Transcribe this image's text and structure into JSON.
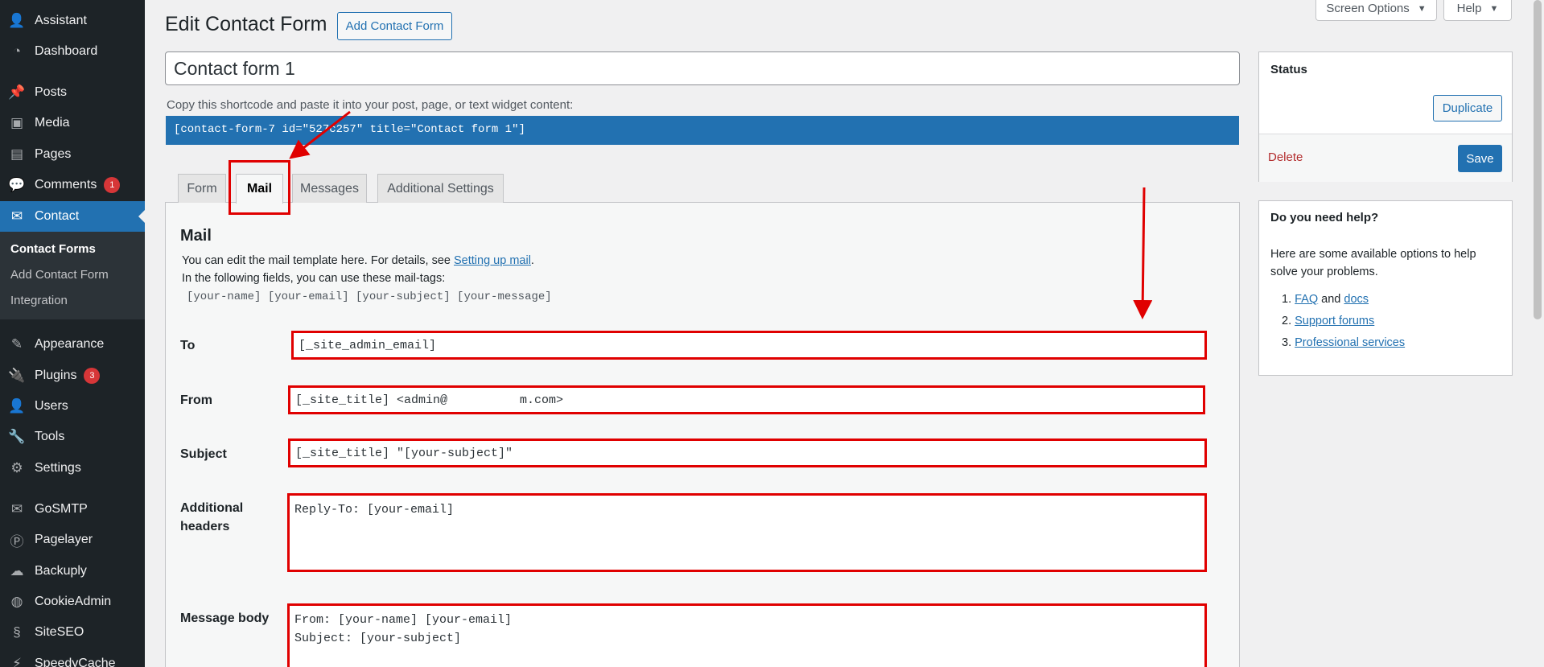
{
  "sidebar": {
    "items": [
      {
        "label": "Assistant",
        "icon": "assistant-icon",
        "glyph": "👤",
        "badge": ""
      },
      {
        "label": "Dashboard",
        "icon": "dashboard-icon",
        "glyph": "◔",
        "badge": ""
      },
      {
        "label": "Posts",
        "icon": "pin-icon",
        "glyph": "📌",
        "badge": ""
      },
      {
        "label": "Media",
        "icon": "media-icon",
        "glyph": "▣",
        "badge": ""
      },
      {
        "label": "Pages",
        "icon": "pages-icon",
        "glyph": "▤",
        "badge": ""
      },
      {
        "label": "Comments",
        "icon": "comment-icon",
        "glyph": "💬",
        "badge": "1"
      },
      {
        "label": "Contact",
        "icon": "mail-icon",
        "glyph": "✉",
        "badge": ""
      },
      {
        "label": "Appearance",
        "icon": "brush-icon",
        "glyph": "✎",
        "badge": ""
      },
      {
        "label": "Plugins",
        "icon": "plugin-icon",
        "glyph": "🔌",
        "badge": "3"
      },
      {
        "label": "Users",
        "icon": "users-icon",
        "glyph": "👤",
        "badge": ""
      },
      {
        "label": "Tools",
        "icon": "wrench-icon",
        "glyph": "🔧",
        "badge": ""
      },
      {
        "label": "Settings",
        "icon": "settings-icon",
        "glyph": "⚙",
        "badge": ""
      },
      {
        "label": "GoSMTP",
        "icon": "envelope-icon",
        "glyph": "✉",
        "badge": ""
      },
      {
        "label": "Pagelayer",
        "icon": "pagelayer-icon",
        "glyph": "Ⓟ",
        "badge": ""
      },
      {
        "label": "Backuply",
        "icon": "cloud-icon",
        "glyph": "☁",
        "badge": ""
      },
      {
        "label": "CookieAdmin",
        "icon": "cookie-icon",
        "glyph": "◍",
        "badge": ""
      },
      {
        "label": "SiteSEO",
        "icon": "siteseo-icon",
        "glyph": "§",
        "badge": ""
      },
      {
        "label": "SpeedyCache",
        "icon": "speedycache-icon",
        "glyph": "⚡",
        "badge": ""
      }
    ],
    "submenu": [
      "Contact Forms",
      "Add Contact Form",
      "Integration"
    ]
  },
  "topbar": {
    "screen_options": "Screen Options",
    "help": "Help"
  },
  "header": {
    "title": "Edit Contact Form",
    "add_new": "Add Contact Form",
    "form_title": "Contact form 1",
    "shortcode_hint": "Copy this shortcode and paste it into your post, page, or text widget content:",
    "shortcode": "[contact-form-7 id=\"527c257\" title=\"Contact form 1\"]"
  },
  "tabs": [
    "Form",
    "Mail",
    "Messages",
    "Additional Settings"
  ],
  "mail": {
    "heading": "Mail",
    "desc_prefix": "You can edit the mail template here. For details, see ",
    "desc_link": "Setting up mail",
    "desc_suffix": ".",
    "desc_line2": "In the following fields, you can use these mail-tags:",
    "mail_tags": "[your-name] [your-email] [your-subject] [your-message]",
    "fields": {
      "to_label": "To",
      "to_value": "[_site_admin_email]",
      "from_label": "From",
      "from_value": "[_site_title] <admin@          m.com>",
      "subject_label": "Subject",
      "subject_value": "[_site_title] \"[your-subject]\"",
      "headers_label_1": "Additional",
      "headers_label_2": "headers",
      "headers_value": "Reply-To: [your-email]",
      "body_label": "Message body",
      "body_value": "From: [your-name] [your-email]\nSubject: [your-subject]"
    }
  },
  "status_box": {
    "title": "Status",
    "duplicate": "Duplicate",
    "delete": "Delete",
    "save": "Save"
  },
  "help_box": {
    "title": "Do you need help?",
    "intro": "Here are some available options to help solve your problems.",
    "item1_num": "1.",
    "item1_link_a": "FAQ",
    "item1_and": " and ",
    "item1_link_b": "docs",
    "item2_num": "2.",
    "item2_link": "Support forums",
    "item3_num": "3.",
    "item3_link": "Professional services"
  },
  "colors": {
    "sidebar": "#1d2327",
    "accent": "#2271b1",
    "annotation": "#e00000"
  }
}
